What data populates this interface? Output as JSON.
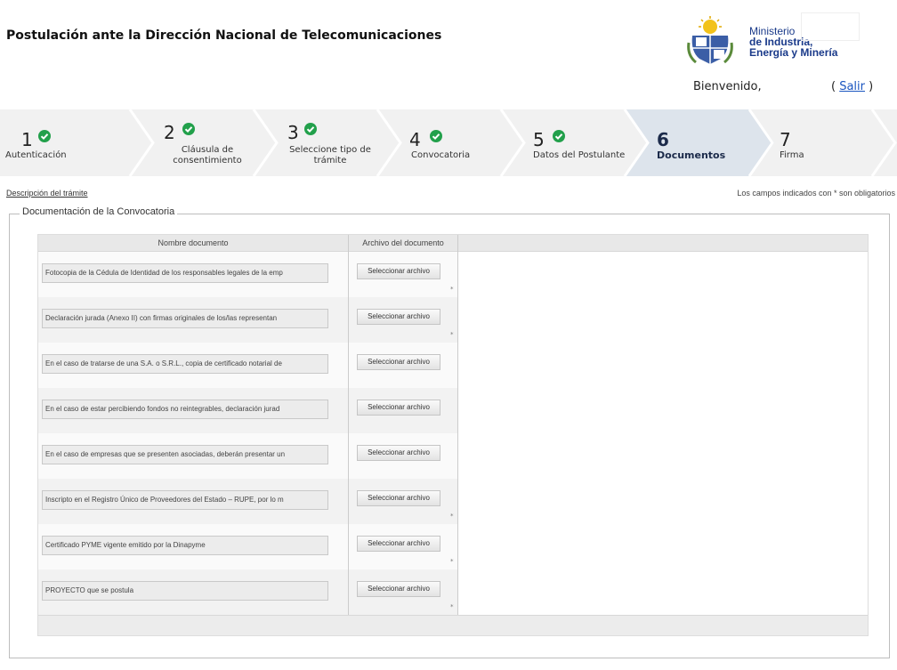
{
  "header": {
    "title": "Postulación ante la Dirección Nacional de Telecomunicaciones",
    "welcome": "Bienvenido,",
    "logout_open": "( ",
    "logout_label": "Salir",
    "logout_close": " )"
  },
  "logo": {
    "line1": "Ministerio",
    "line2": "de Industria,",
    "line3": "Energía y Minería",
    "icon": "uruguay-coat-of-arms"
  },
  "steps": [
    {
      "number": "1",
      "label": "Autenticación",
      "completed": true
    },
    {
      "number": "2",
      "label": "Cláusula de consentimiento",
      "completed": true
    },
    {
      "number": "3",
      "label": "Seleccione tipo de trámite",
      "completed": true
    },
    {
      "number": "4",
      "label": "Convocatoria",
      "completed": true
    },
    {
      "number": "5",
      "label": "Datos del Postulante",
      "completed": true
    },
    {
      "number": "6",
      "label": "Documentos",
      "active": true
    },
    {
      "number": "7",
      "label": "Firma"
    }
  ],
  "links": {
    "description": "Descripción del trámite",
    "required_note": "Los campos indicados con * son obligatorios"
  },
  "section": {
    "legend": "Documentación de la Convocatoria"
  },
  "table": {
    "col_name": "Nombre documento",
    "col_file": "Archivo del documento",
    "button_label": "Seleccionar archivo",
    "rows": [
      {
        "name": "Fotocopia de la Cédula de Identidad de los responsables legales de la emp",
        "mark": "*"
      },
      {
        "name": "Declaración jurada (Anexo II) con firmas originales de los/las representan",
        "mark": "*"
      },
      {
        "name": "En el caso de tratarse de una S.A. o S.R.L., copia de certificado notarial de",
        "mark": ""
      },
      {
        "name": "En el caso de estar percibiendo fondos no reintegrables, declaración jurad",
        "mark": ""
      },
      {
        "name": "En el caso de empresas que se presenten asociadas, deberán presentar un",
        "mark": ""
      },
      {
        "name": "Inscripto en el Registro Único de Proveedores del Estado – RUPE, por lo m",
        "mark": "*"
      },
      {
        "name": "Certificado PYME vigente emitido por la Dinapyme",
        "mark": "*"
      },
      {
        "name": "PROYECTO que se postula",
        "mark": "*"
      }
    ]
  },
  "colors": {
    "check_green": "#22a04b",
    "active_step_bg": "#dde4ec",
    "link_blue": "#1a55c0",
    "ministry_blue": "#1a3a8a"
  }
}
